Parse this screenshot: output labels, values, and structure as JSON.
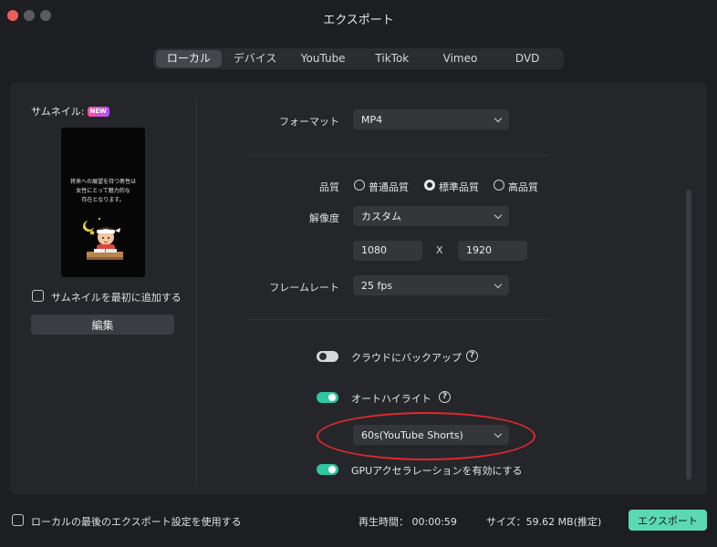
{
  "window": {
    "title": "エクスポート"
  },
  "tabs": [
    {
      "label": "ローカル",
      "active": true
    },
    {
      "label": "デバイス"
    },
    {
      "label": "YouTube"
    },
    {
      "label": "TikTok"
    },
    {
      "label": "Vimeo"
    },
    {
      "label": "DVD"
    }
  ],
  "thumbnail": {
    "label": "サムネイル:",
    "badge": "NEW",
    "preview_text": [
      "将来への展望を持つ男性は",
      "女性にとって魅力的な",
      "存在となります。"
    ],
    "add_first_label": "サムネイルを最初に追加する",
    "edit_button": "編集"
  },
  "format": {
    "label": "フォーマット",
    "value": "MP4"
  },
  "quality": {
    "label": "品質",
    "options": [
      "普通品質",
      "標準品質",
      "高品質"
    ],
    "selected": "標準品質"
  },
  "resolution": {
    "label": "解像度",
    "value": "カスタム",
    "width": "1080",
    "height": "1920",
    "separator": "X"
  },
  "framerate": {
    "label": "フレームレート",
    "value": "25 fps"
  },
  "cloud_backup": {
    "label": "クラウドにバックアップ",
    "enabled": false
  },
  "auto_highlight": {
    "label": "オートハイライト",
    "enabled": true,
    "duration_value": "60s(YouTube Shorts)"
  },
  "gpu": {
    "label": "GPUアクセラレーションを有効にする",
    "enabled": true
  },
  "footer": {
    "use_last_settings": "ローカルの最後のエクスポート設定を使用する",
    "duration": "再生時間： 00:00:59",
    "size": "サイズ：59.62 MB(推定)",
    "export_button": "エクスポート"
  },
  "colors": {
    "accent": "#2fc7a0",
    "export_button": "#5bd9b3",
    "highlight_ring": "#e0272f"
  }
}
